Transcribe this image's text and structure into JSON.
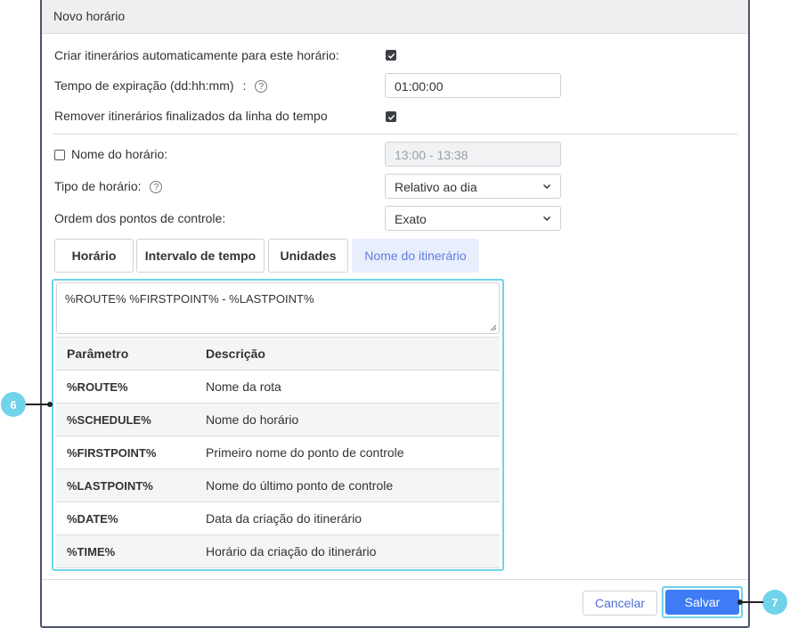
{
  "dialog": {
    "title": "Novo horário",
    "auto_routes_label": "Criar itinerários automaticamente para este horário:",
    "auto_routes_checked": true,
    "expiration_label": "Tempo de expiração (dd:hh:mm)",
    "expiration_colon": ":",
    "expiration_value": "01:00:00",
    "remove_finished_label": "Remover itinerários finalizados da linha do tempo",
    "remove_finished_checked": true,
    "schedule_name_label": "Nome do horário:",
    "schedule_name_checked": false,
    "schedule_name_value": "13:00 - 13:38",
    "schedule_type_label": "Tipo de horário:",
    "schedule_type_value": "Relativo ao dia",
    "checkpoint_order_label": "Ordem dos pontos de controle:",
    "checkpoint_order_value": "Exato",
    "help_glyph": "?"
  },
  "tabs": [
    {
      "label": "Horário",
      "active": false
    },
    {
      "label": "Intervalo de tempo",
      "active": false
    },
    {
      "label": "Unidades",
      "active": false
    },
    {
      "label": "Nome do itinerário",
      "active": true
    }
  ],
  "route_name": {
    "template_text": "%ROUTE% %FIRSTPOINT% - %LASTPOINT%",
    "columns": [
      "Parâmetro",
      "Descrição"
    ],
    "rows": [
      {
        "param": "%ROUTE%",
        "desc": "Nome da rota"
      },
      {
        "param": "%SCHEDULE%",
        "desc": "Nome do horário"
      },
      {
        "param": "%FIRSTPOINT%",
        "desc": "Primeiro nome do ponto de controle"
      },
      {
        "param": "%LASTPOINT%",
        "desc": "Nome do último ponto de controle"
      },
      {
        "param": "%DATE%",
        "desc": "Data da criação do itinerário"
      },
      {
        "param": "%TIME%",
        "desc": "Horário da criação do itinerário"
      }
    ]
  },
  "footer": {
    "cancel_label": "Cancelar",
    "save_label": "Salvar"
  },
  "callouts": {
    "panel": "6",
    "save": "7"
  },
  "colors": {
    "accent": "#3d7cf5",
    "highlight": "#6fd3ea",
    "active_tab_text": "#5b7fe6"
  }
}
